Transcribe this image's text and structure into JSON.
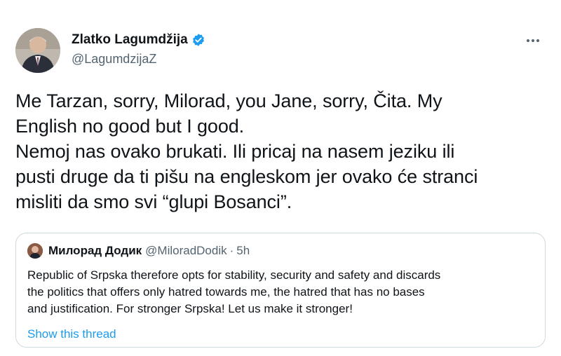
{
  "author": {
    "name": "Zlatko Lagumdžija",
    "handle": "@LagumdzijaZ",
    "verified_color": "#1d9bf0"
  },
  "tweet": {
    "lines": [
      "Me Tarzan, sorry, Milorad, you Jane, sorry, Čita. My",
      "English no good but I good.",
      "Nemoj nas ovako brukati. Ili pricaj na nasem jeziku ili",
      "pusti druge da ti pišu na engleskom jer ovako će stranci",
      "misliti da smo svi “glupi Bosanci”."
    ]
  },
  "quoted": {
    "name": "Милорад Додик",
    "handle": "@MiloradDodik",
    "separator": "·",
    "time": "5h",
    "lines": [
      "Republic of Srpska therefore opts for stability,  security and safety and discards",
      "the politics that offers only hatred towards me,  the hatred that has no bases",
      "and justification. For  stronger Srpska! Let us make it stronger!"
    ],
    "show_thread_label": "Show this thread"
  },
  "icons": {
    "more": "more-dots-icon",
    "verified": "verified-badge-icon"
  },
  "colors": {
    "link": "#1d9bf0",
    "secondary_text": "#536471",
    "border": "#cfd9de"
  }
}
